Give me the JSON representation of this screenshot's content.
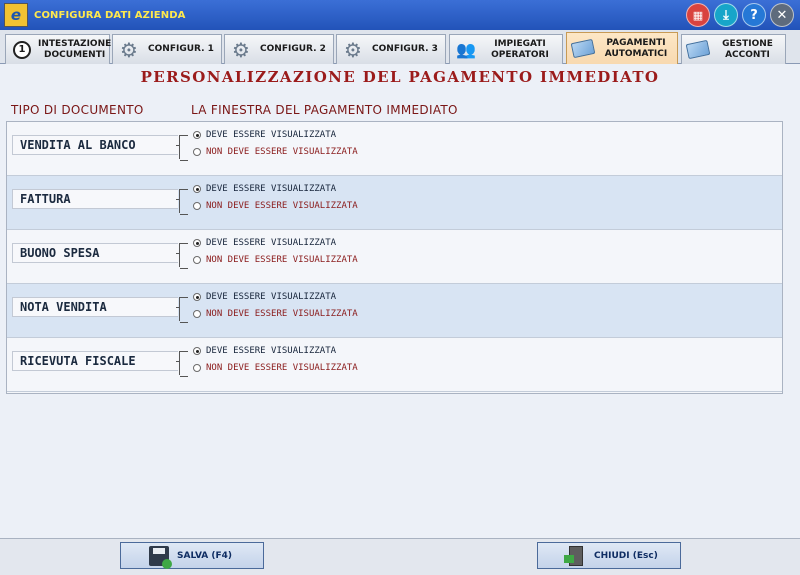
{
  "window": {
    "title": "CONFIGURA DATI AZIENDA",
    "app_icon_glyph": "e",
    "buttons": {
      "calculator": "calculator-icon",
      "download": "download-icon",
      "help": "?",
      "close": "✕"
    }
  },
  "tabs": [
    {
      "line1": "INTESTAZIONE",
      "line2": "DOCUMENTI",
      "icon": "number-1-icon",
      "icon_glyph": "1"
    },
    {
      "line1": "CONFIGUR. 1",
      "line2": "",
      "icon": "gear-icon"
    },
    {
      "line1": "CONFIGUR. 2",
      "line2": "",
      "icon": "gear-icon"
    },
    {
      "line1": "CONFIGUR. 3",
      "line2": "",
      "icon": "gear-icon"
    },
    {
      "line1": "IMPIEGATI",
      "line2": "OPERATORI",
      "icon": "people-icon"
    },
    {
      "line1": "PAGAMENTI",
      "line2": "AUTOMATICI",
      "icon": "card-icon",
      "active": true
    },
    {
      "line1": "GESTIONE",
      "line2": "ACCONTI",
      "icon": "card-icon"
    }
  ],
  "main": {
    "heading": "PERSONALIZZAZIONE DEL PAGAMENTO IMMEDIATO",
    "col_doc": "TIPO DI DOCUMENTO",
    "col_window": "LA FINESTRA DEL PAGAMENTO IMMEDIATO",
    "option_yes": "DEVE ESSERE VISUALIZZATA",
    "option_no": "NON DEVE ESSERE VISUALIZZATA",
    "documents": [
      {
        "label": "VENDITA AL BANCO",
        "selected": "yes"
      },
      {
        "label": "FATTURA",
        "selected": "yes"
      },
      {
        "label": "BUONO SPESA",
        "selected": "yes"
      },
      {
        "label": "NOTA VENDITA",
        "selected": "yes"
      },
      {
        "label": "RICEVUTA FISCALE",
        "selected": "yes"
      }
    ]
  },
  "footer": {
    "save_label": "SALVA (F4)",
    "close_label": "CHIUDI  (Esc)"
  },
  "colors": {
    "titlebar": "#2253b9",
    "title_text": "#ffe94d",
    "heading": "#9b1b1b",
    "active_tab": "#fde7c6",
    "row_alt": "#d8e4f3"
  }
}
